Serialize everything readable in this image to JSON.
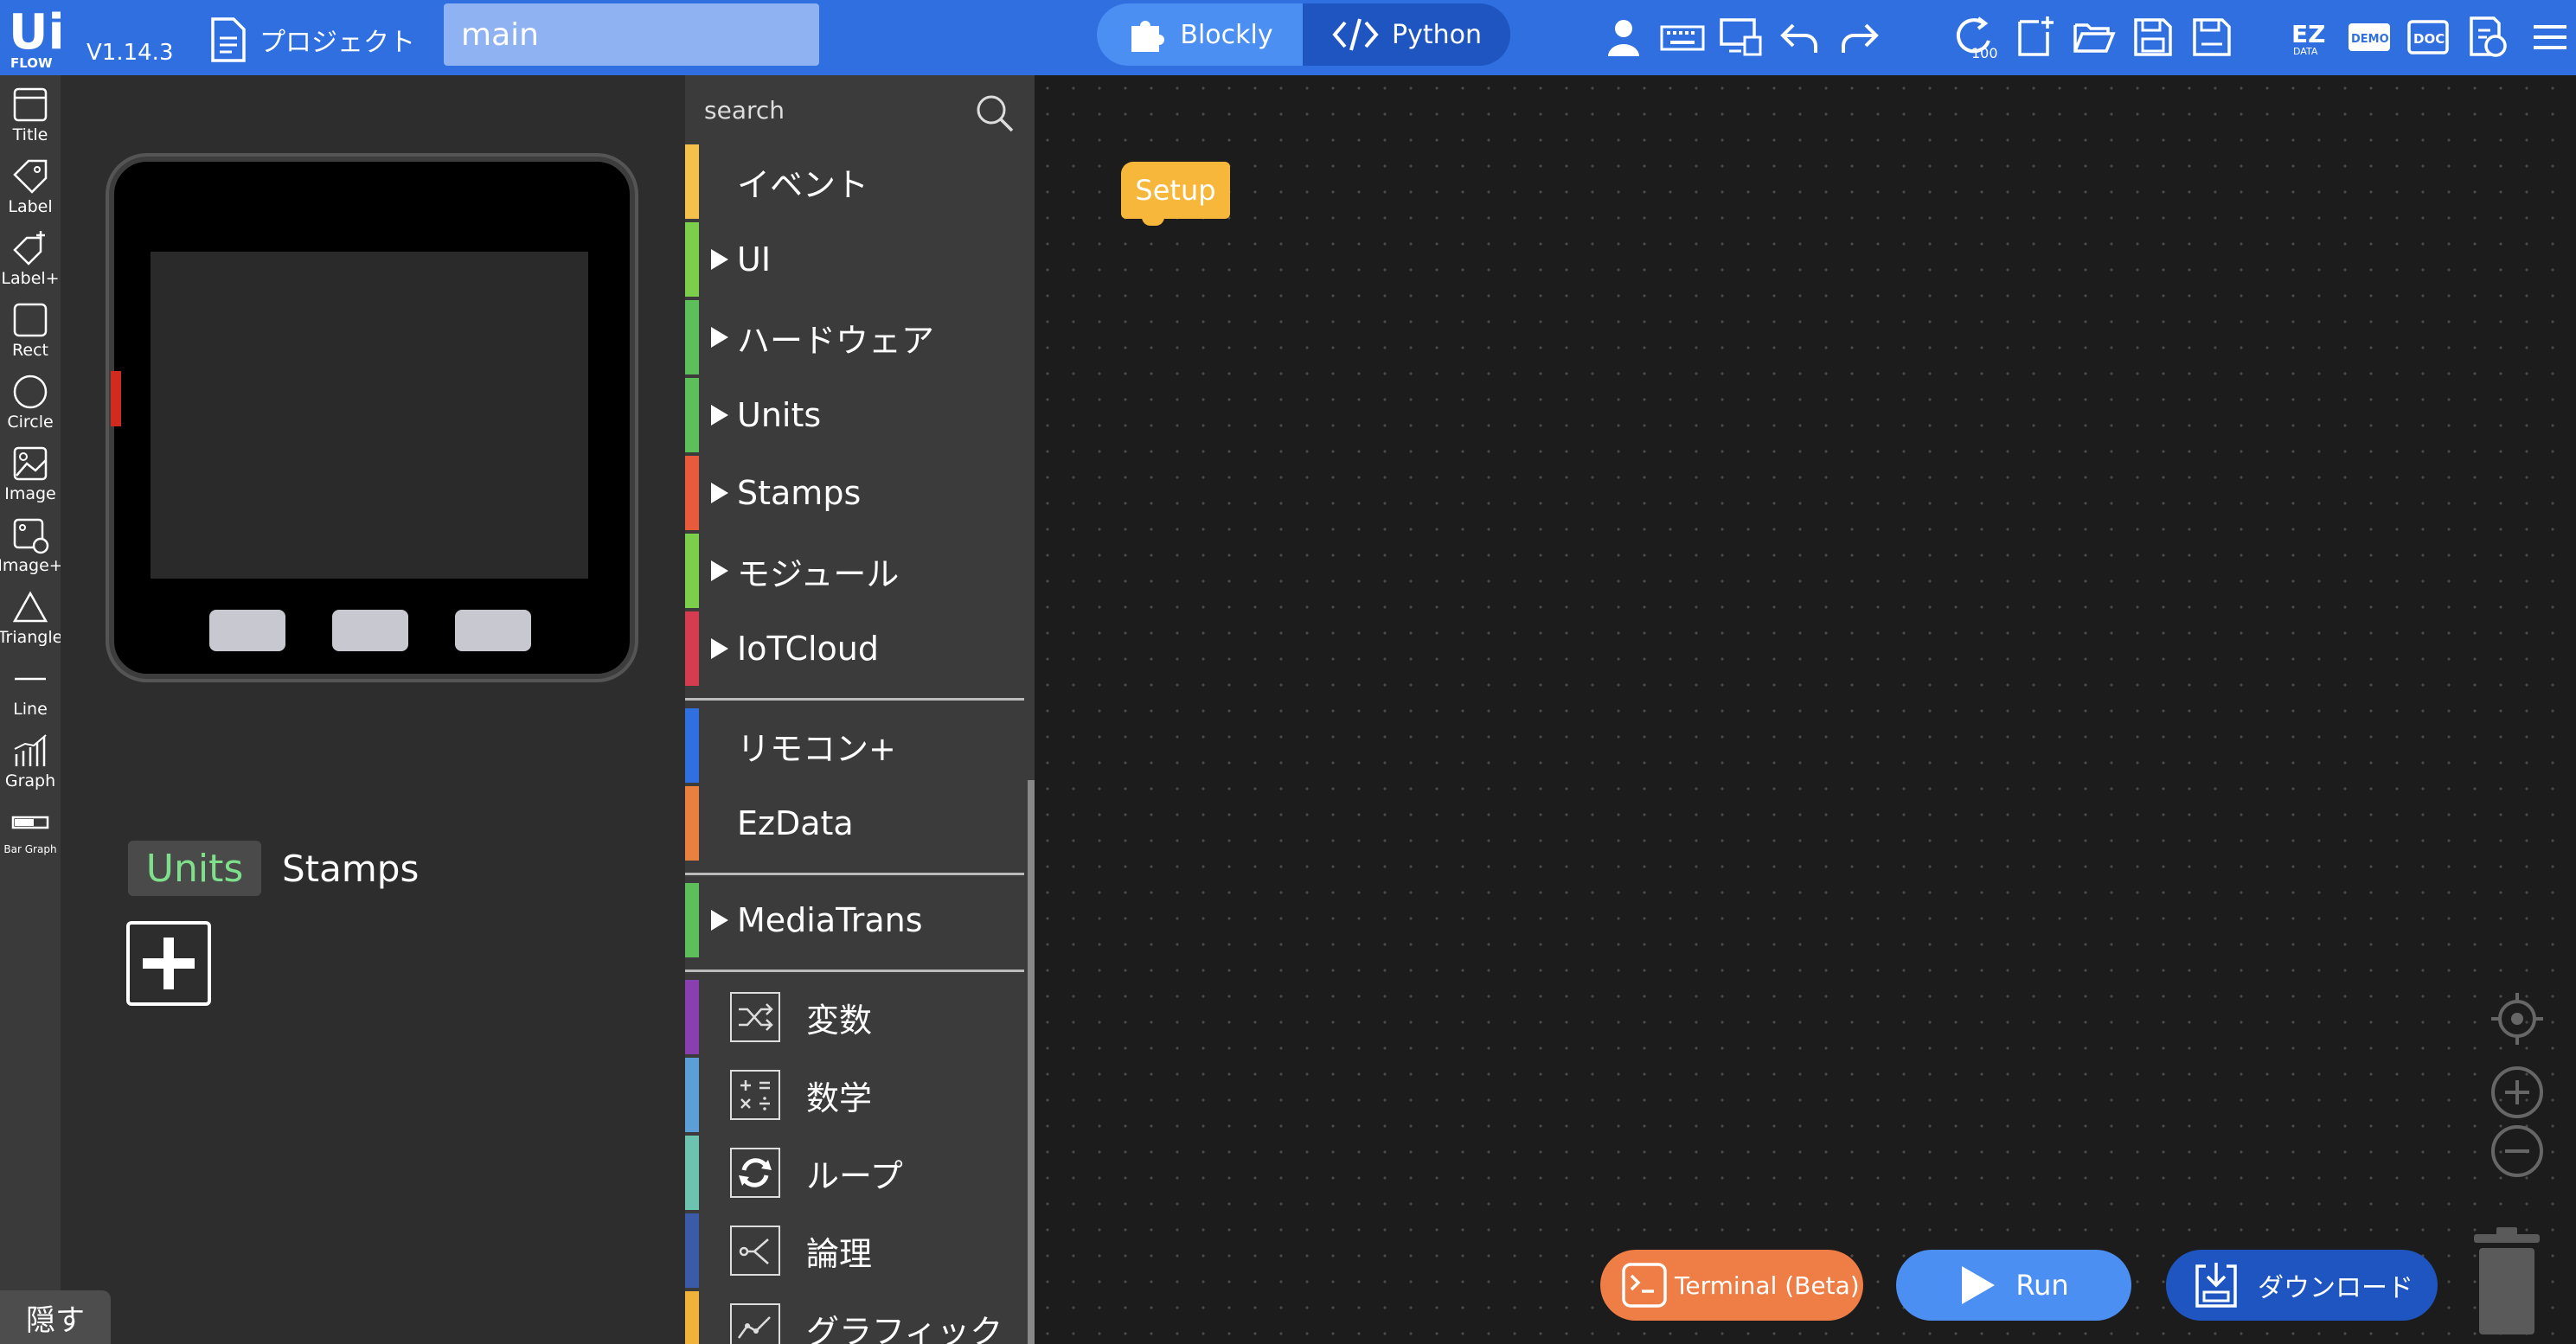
{
  "topbar": {
    "version": "V1.14.3",
    "project_label": "プロジェクト",
    "file_name": "main",
    "modes": {
      "blockly": "Blockly",
      "python": "Python"
    }
  },
  "tools": [
    "Title",
    "Label",
    "Label+",
    "Rect",
    "Circle",
    "Image",
    "Image+",
    "Triangle",
    "Line",
    "Graph",
    "Bar Graph"
  ],
  "hide_label": "隠す",
  "unit_tabs": {
    "units": "Units",
    "stamps": "Stamps"
  },
  "toolbox": {
    "search_placeholder": "search",
    "categories": [
      {
        "label": "イベント",
        "color": "#f6c14b"
      },
      {
        "label": "UI",
        "color": "#7ccf4a"
      },
      {
        "label": "ハードウェア",
        "color": "#5cbf5a"
      },
      {
        "label": "Units",
        "color": "#5cbf5a"
      },
      {
        "label": "Stamps",
        "color": "#e85a3c"
      },
      {
        "label": "モジュール",
        "color": "#7ccf4a"
      },
      {
        "label": "IoTCloud",
        "color": "#d63c50"
      },
      {
        "label": "リモコン+",
        "color": "#2f6fe0"
      },
      {
        "label": "EzData",
        "color": "#e88040"
      },
      {
        "label": "MediaTrans",
        "color": "#5cbf5a"
      },
      {
        "label": "変数",
        "color": "#8a3fb0"
      },
      {
        "label": "数学",
        "color": "#5c9fd6"
      },
      {
        "label": "ループ",
        "color": "#6cc3b0"
      },
      {
        "label": "論理",
        "color": "#3b5ba8"
      },
      {
        "label": "グラフィック",
        "color": "#f0b23a"
      }
    ]
  },
  "workspace": {
    "setup_block": "Setup",
    "terminal_label": "Terminal (Beta)",
    "run_label": "Run",
    "download_label": "ダウンロード"
  },
  "colors": {
    "topbar": "#2f6fe0",
    "accent_blue": "#4c8ff2",
    "dark_blue": "#1f55c0",
    "orange": "#ee7d46",
    "units_green": "#7ee08a"
  }
}
